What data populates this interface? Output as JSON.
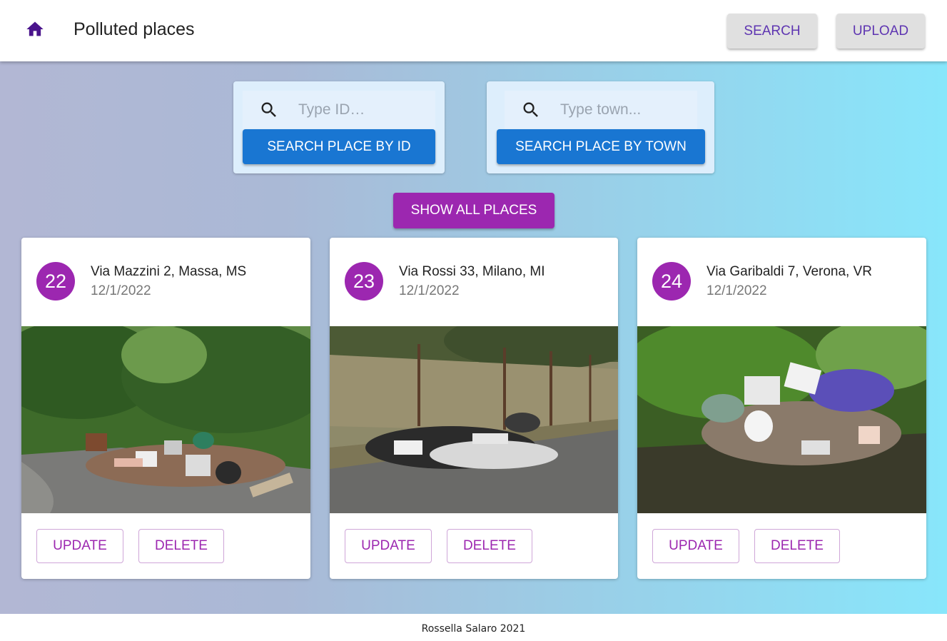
{
  "app": {
    "title": "Polluted places"
  },
  "header": {
    "search_label": "SEARCH",
    "upload_label": "UPLOAD"
  },
  "search_by_id": {
    "placeholder": "Type ID…",
    "button_label": "SEARCH PLACE BY ID"
  },
  "search_by_town": {
    "placeholder": "Type town...",
    "button_label": "SEARCH PLACE BY TOWN"
  },
  "show_all_label": "SHOW ALL PLACES",
  "places": [
    {
      "id": "22",
      "address": "Via Mazzini 2, Massa, MS",
      "date": "12/1/2022",
      "update_label": "UPDATE",
      "delete_label": "DELETE"
    },
    {
      "id": "23",
      "address": "Via Rossi 33, Milano, MI",
      "date": "12/1/2022",
      "update_label": "UPDATE",
      "delete_label": "DELETE"
    },
    {
      "id": "24",
      "address": "Via Garibaldi 7, Verona, VR",
      "date": "12/1/2022",
      "update_label": "UPDATE",
      "delete_label": "DELETE"
    }
  ],
  "footer": {
    "text": "Rossella Salaro 2021"
  },
  "colors": {
    "primary": "#9c27b0",
    "blue": "#1976d2",
    "header_text": "#5e35b1"
  },
  "icons": {
    "home": "home-icon",
    "search": "search-icon"
  }
}
